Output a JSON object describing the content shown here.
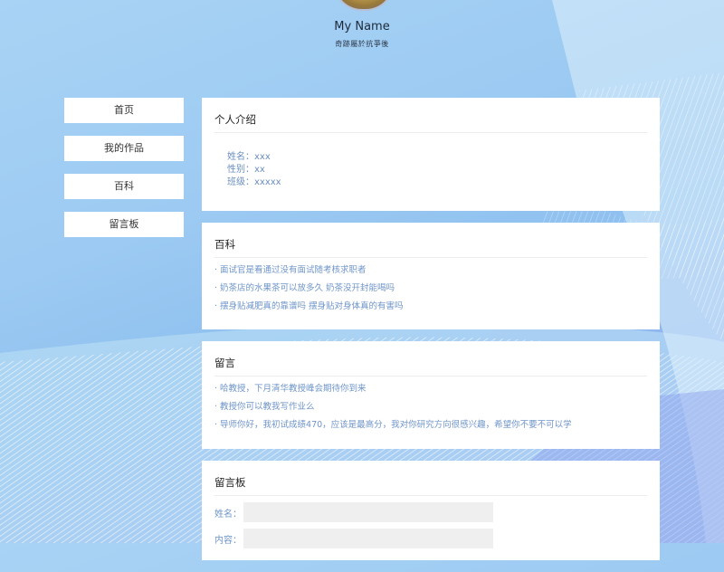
{
  "profile": {
    "name": "My Name",
    "motto": "奇跡屬於抗爭後"
  },
  "nav": {
    "items": [
      {
        "label": "首页"
      },
      {
        "label": "我的作品"
      },
      {
        "label": "百科"
      },
      {
        "label": "留言板"
      }
    ]
  },
  "intro": {
    "title": "个人介绍",
    "rows": [
      {
        "text": "姓名：xxx"
      },
      {
        "text": "性别：xx"
      },
      {
        "text": "班级：xxxxx"
      }
    ]
  },
  "baike": {
    "title": "百科",
    "links": [
      {
        "text": "· 面试官是看通过没有面试随考核求职者"
      },
      {
        "text": "· 奶茶店的水果茶可以放多久 奶茶没开封能喝吗"
      },
      {
        "text": "· 摆身贴减肥真的靠谱吗 摆身贴对身体真的有害吗"
      }
    ]
  },
  "messages": {
    "title": "留言",
    "links": [
      {
        "text": "· 哈教授，下月清华教授峰会期待你到来"
      },
      {
        "text": "· 教授你可以教我写作业么"
      },
      {
        "text": "· 导师你好，我初试成绩470，应该是最高分，我对你研究方向很感兴趣，希望你不要不可以学"
      }
    ]
  },
  "board": {
    "title": "留言板",
    "name_label": "姓名：",
    "name_value": "",
    "content_label": "内容：",
    "content_value": ""
  },
  "colors": {
    "link": "#6f95c9",
    "card": "#ffffff",
    "input_bg": "#efefef"
  }
}
